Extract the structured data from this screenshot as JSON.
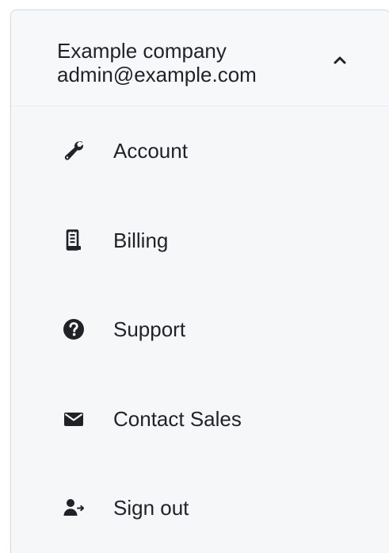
{
  "account_menu": {
    "company_name": "Example company",
    "email": "admin@example.com",
    "expanded": true,
    "toggle_icon": "chevron-up-icon",
    "items": [
      {
        "label": "Account",
        "icon": "wrench-icon"
      },
      {
        "label": "Billing",
        "icon": "receipt-icon"
      },
      {
        "label": "Support",
        "icon": "question-circle-icon"
      },
      {
        "label": "Contact Sales",
        "icon": "envelope-icon"
      },
      {
        "label": "Sign out",
        "icon": "user-sign-out-icon"
      }
    ]
  },
  "colors": {
    "text": "#1f2328",
    "icon": "#1f2328",
    "background": "#f6f7f9",
    "border": "#d6d9de"
  }
}
